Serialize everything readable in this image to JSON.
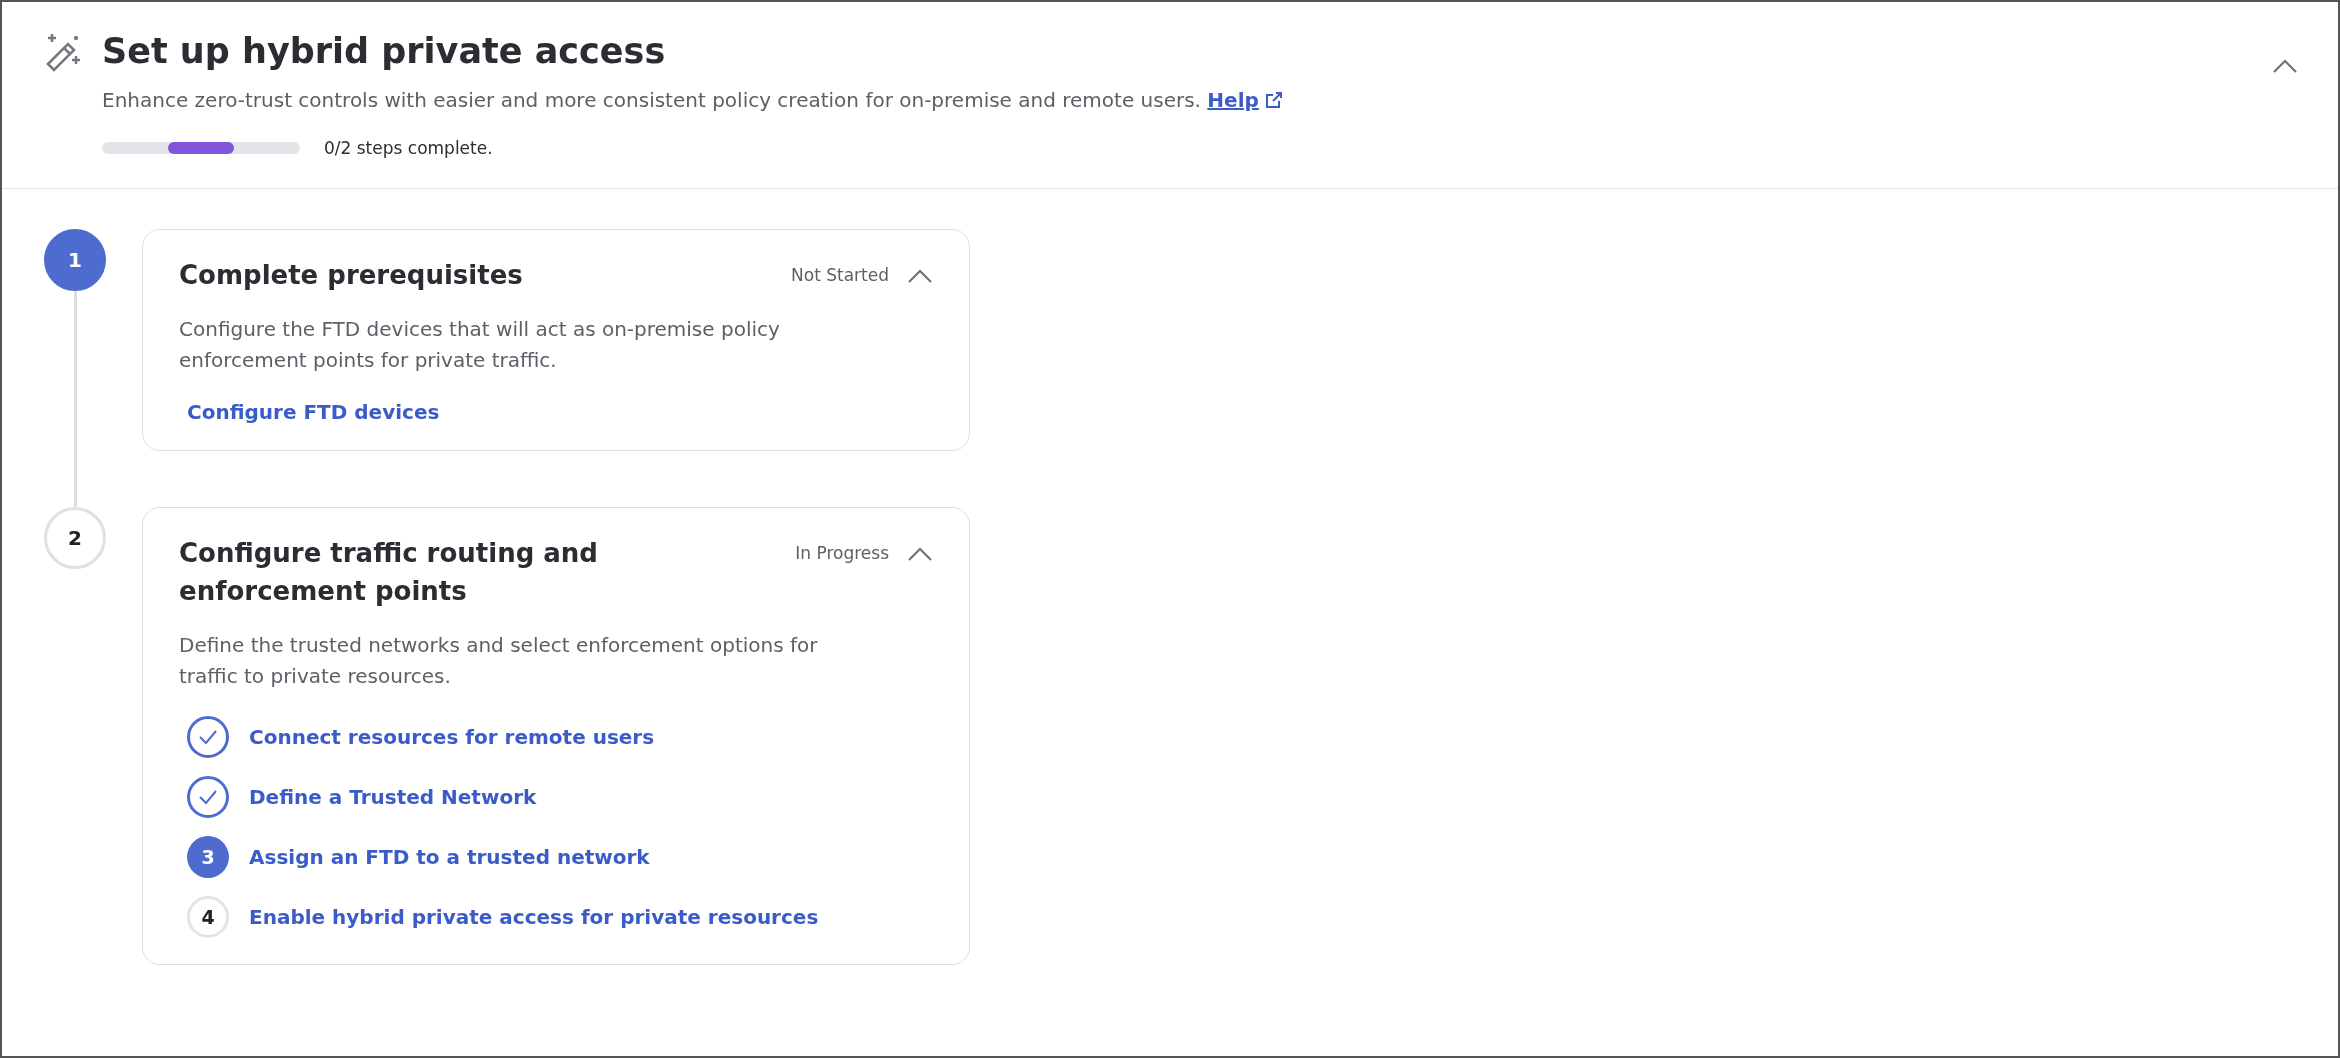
{
  "header": {
    "title": "Set up hybrid private access",
    "description": "Enhance zero-trust controls with easier and more consistent policy creation for on-premise and remote users.",
    "help_link": "Help",
    "expanded": true,
    "progress_segments": [
      {
        "active": false
      },
      {
        "active": true
      },
      {
        "active": false
      }
    ],
    "progress_text": "0/2 steps complete."
  },
  "steps": [
    {
      "number": "1",
      "current": true,
      "title": "Complete prerequisites",
      "state_label": "Not Started",
      "expanded": true,
      "description": "Configure the FTD devices that will act as on-premise policy enforcement points for private traffic.",
      "links": [
        {
          "label": "Configure FTD devices",
          "kind": "plain"
        }
      ]
    },
    {
      "number": "2",
      "current": false,
      "title": "Configure traffic routing and enforcement points",
      "state_label": "In Progress",
      "expanded": true,
      "description": "Define the trusted networks and select enforcement options for traffic to private resources.",
      "links": [
        {
          "label": "Connect resources for remote users",
          "kind": "done"
        },
        {
          "label": "Define a Trusted Network",
          "kind": "done"
        },
        {
          "label": "Assign an FTD to a trusted network",
          "kind": "current",
          "number": "3"
        },
        {
          "label": "Enable hybrid private access for private resources",
          "kind": "todo",
          "number": "4"
        }
      ]
    }
  ]
}
